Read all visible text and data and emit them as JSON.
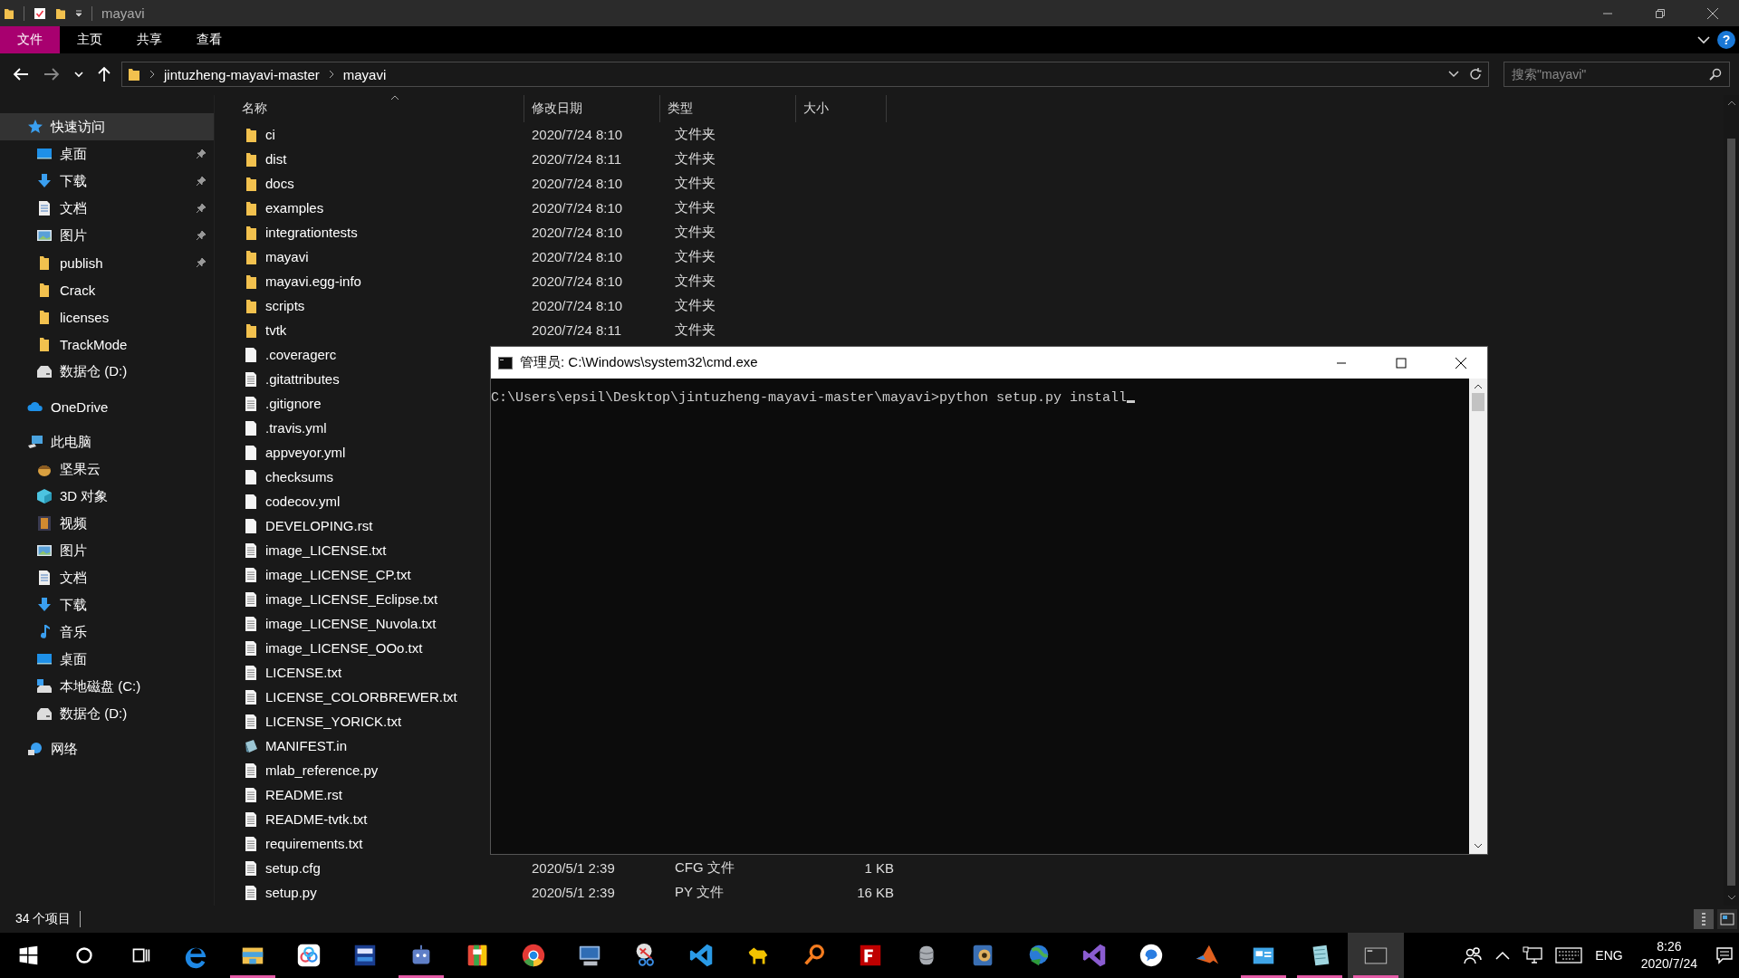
{
  "window": {
    "title": "mayavi"
  },
  "ribbon": {
    "tabs": [
      {
        "label": "文件",
        "selected": true
      },
      {
        "label": "主页",
        "selected": false
      },
      {
        "label": "共享",
        "selected": false
      },
      {
        "label": "查看",
        "selected": false
      }
    ],
    "help": "?"
  },
  "address": {
    "path": [
      "jintuzheng-mayavi-master",
      "mayavi"
    ]
  },
  "search": {
    "placeholder": "搜索\"mayavi\""
  },
  "sidebar": {
    "items": [
      {
        "label": "快速访问",
        "kind": "star",
        "selected": true,
        "children": [
          {
            "label": "桌面",
            "kind": "desktop",
            "pinned": true,
            "selected": false
          },
          {
            "label": "下载",
            "kind": "download",
            "pinned": true,
            "selected": false
          },
          {
            "label": "文档",
            "kind": "document",
            "pinned": true,
            "selected": false
          },
          {
            "label": "图片",
            "kind": "pictures",
            "pinned": true,
            "selected": false
          },
          {
            "label": "publish",
            "kind": "folder",
            "pinned": true,
            "selected": false
          },
          {
            "label": "Crack",
            "kind": "folder",
            "pinned": false,
            "selected": false
          },
          {
            "label": "licenses",
            "kind": "folder",
            "pinned": false,
            "selected": false
          },
          {
            "label": "TrackMode",
            "kind": "folder",
            "pinned": false,
            "selected": false
          },
          {
            "label": "数据仓 (D:)",
            "kind": "drive",
            "pinned": false,
            "selected": false
          }
        ]
      },
      {
        "label": "OneDrive",
        "kind": "cloud",
        "selected": false
      },
      {
        "label": "此电脑",
        "kind": "pc",
        "selected": false,
        "children": [
          {
            "label": "坚果云",
            "kind": "nut",
            "selected": false
          },
          {
            "label": "3D 对象",
            "kind": "cube",
            "selected": false
          },
          {
            "label": "视频",
            "kind": "video",
            "selected": false
          },
          {
            "label": "图片",
            "kind": "pictures",
            "selected": false
          },
          {
            "label": "文档",
            "kind": "document",
            "selected": false
          },
          {
            "label": "下载",
            "kind": "download",
            "selected": false
          },
          {
            "label": "音乐",
            "kind": "music",
            "selected": false
          },
          {
            "label": "桌面",
            "kind": "desktop",
            "selected": false
          },
          {
            "label": "本地磁盘 (C:)",
            "kind": "system-drive",
            "selected": false
          },
          {
            "label": "数据仓 (D:)",
            "kind": "drive",
            "selected": false
          }
        ]
      },
      {
        "label": "网络",
        "kind": "network",
        "selected": false
      }
    ]
  },
  "table": {
    "columns": [
      "名称",
      "修改日期",
      "类型",
      "大小"
    ],
    "rows": [
      {
        "kind": "folder",
        "name": "ci",
        "modified": "2020/7/24 8:10",
        "type": "文件夹"
      },
      {
        "kind": "folder",
        "name": "dist",
        "modified": "2020/7/24 8:11",
        "type": "文件夹"
      },
      {
        "kind": "folder",
        "name": "docs",
        "modified": "2020/7/24 8:10",
        "type": "文件夹"
      },
      {
        "kind": "folder",
        "name": "examples",
        "modified": "2020/7/24 8:10",
        "type": "文件夹"
      },
      {
        "kind": "folder",
        "name": "integrationtests",
        "modified": "2020/7/24 8:10",
        "type": "文件夹"
      },
      {
        "kind": "folder",
        "name": "mayavi",
        "modified": "2020/7/24 8:10",
        "type": "文件夹"
      },
      {
        "kind": "folder",
        "name": "mayavi.egg-info",
        "modified": "2020/7/24 8:10",
        "type": "文件夹"
      },
      {
        "kind": "folder",
        "name": "scripts",
        "modified": "2020/7/24 8:10",
        "type": "文件夹"
      },
      {
        "kind": "folder",
        "name": "tvtk",
        "modified": "2020/7/24 8:11",
        "type": "文件夹"
      },
      {
        "kind": "file",
        "name": ".coveragerc"
      },
      {
        "kind": "text",
        "name": ".gitattributes"
      },
      {
        "kind": "text",
        "name": ".gitignore"
      },
      {
        "kind": "file",
        "name": ".travis.yml"
      },
      {
        "kind": "file",
        "name": "appveyor.yml"
      },
      {
        "kind": "file",
        "name": "checksums"
      },
      {
        "kind": "file",
        "name": "codecov.yml"
      },
      {
        "kind": "file",
        "name": "DEVELOPING.rst"
      },
      {
        "kind": "text",
        "name": "image_LICENSE.txt"
      },
      {
        "kind": "text",
        "name": "image_LICENSE_CP.txt"
      },
      {
        "kind": "text",
        "name": "image_LICENSE_Eclipse.txt"
      },
      {
        "kind": "text",
        "name": "image_LICENSE_Nuvola.txt"
      },
      {
        "kind": "text",
        "name": "image_LICENSE_OOo.txt"
      },
      {
        "kind": "text",
        "name": "LICENSE.txt"
      },
      {
        "kind": "text",
        "name": "LICENSE_COLORBREWER.txt"
      },
      {
        "kind": "text",
        "name": "LICENSE_YORICK.txt"
      },
      {
        "kind": "manifest",
        "name": "MANIFEST.in"
      },
      {
        "kind": "text",
        "name": "mlab_reference.py"
      },
      {
        "kind": "text",
        "name": "README.rst"
      },
      {
        "kind": "text",
        "name": "README-tvtk.txt"
      },
      {
        "kind": "text",
        "name": "requirements.txt"
      },
      {
        "kind": "text",
        "name": "setup.cfg",
        "modified": "2020/5/1 2:39",
        "type": "CFG 文件",
        "size": "1 KB"
      },
      {
        "kind": "text",
        "name": "setup.py",
        "modified": "2020/5/1 2:39",
        "type": "PY 文件",
        "size": "16 KB"
      }
    ]
  },
  "status_bar": {
    "count": "34 个项目",
    "views": [
      {
        "kind": "details",
        "selected": true
      },
      {
        "kind": "tiles",
        "selected": false
      }
    ]
  },
  "console": {
    "title": "管理员: C:\\Windows\\system32\\cmd.exe",
    "lines": [
      "C:\\Users\\epsil\\Desktop\\jintuzheng-mayavi-master\\mayavi>python setup.py install"
    ]
  },
  "taskbar": {
    "apps": [
      {
        "kind": "start",
        "running": false,
        "selected": false
      },
      {
        "kind": "search",
        "running": false,
        "selected": false
      },
      {
        "kind": "taskview",
        "running": false,
        "selected": false
      },
      {
        "kind": "edge",
        "running": false,
        "selected": false
      },
      {
        "kind": "explorer",
        "running": true,
        "selected": false
      },
      {
        "kind": "cloud",
        "running": false,
        "selected": false
      },
      {
        "kind": "ide",
        "running": false,
        "selected": false
      },
      {
        "kind": "robot",
        "running": true,
        "selected": false
      },
      {
        "kind": "colorful",
        "running": false,
        "selected": false
      },
      {
        "kind": "chrome",
        "running": false,
        "selected": false
      },
      {
        "kind": "monitor",
        "running": false,
        "selected": false
      },
      {
        "kind": "scissors",
        "running": false,
        "selected": false
      },
      {
        "kind": "vscode",
        "running": false,
        "selected": false
      },
      {
        "kind": "dog",
        "running": false,
        "selected": false
      },
      {
        "kind": "magnifier",
        "running": false,
        "selected": false
      },
      {
        "kind": "filezilla",
        "running": false,
        "selected": false
      },
      {
        "kind": "database",
        "running": false,
        "selected": false
      },
      {
        "kind": "eye",
        "running": false,
        "selected": false
      },
      {
        "kind": "globe",
        "running": false,
        "selected": false
      },
      {
        "kind": "visualstudio",
        "running": false,
        "selected": false
      },
      {
        "kind": "bluecircle",
        "running": false,
        "selected": false
      },
      {
        "kind": "matlab",
        "running": false,
        "selected": false
      },
      {
        "kind": "appwindow",
        "running": true,
        "selected": false
      },
      {
        "kind": "notepad",
        "running": true,
        "selected": false
      },
      {
        "kind": "terminal",
        "running": true,
        "selected": true
      }
    ],
    "language": "ENG",
    "time": "8:26",
    "date": "2020/7/24"
  }
}
